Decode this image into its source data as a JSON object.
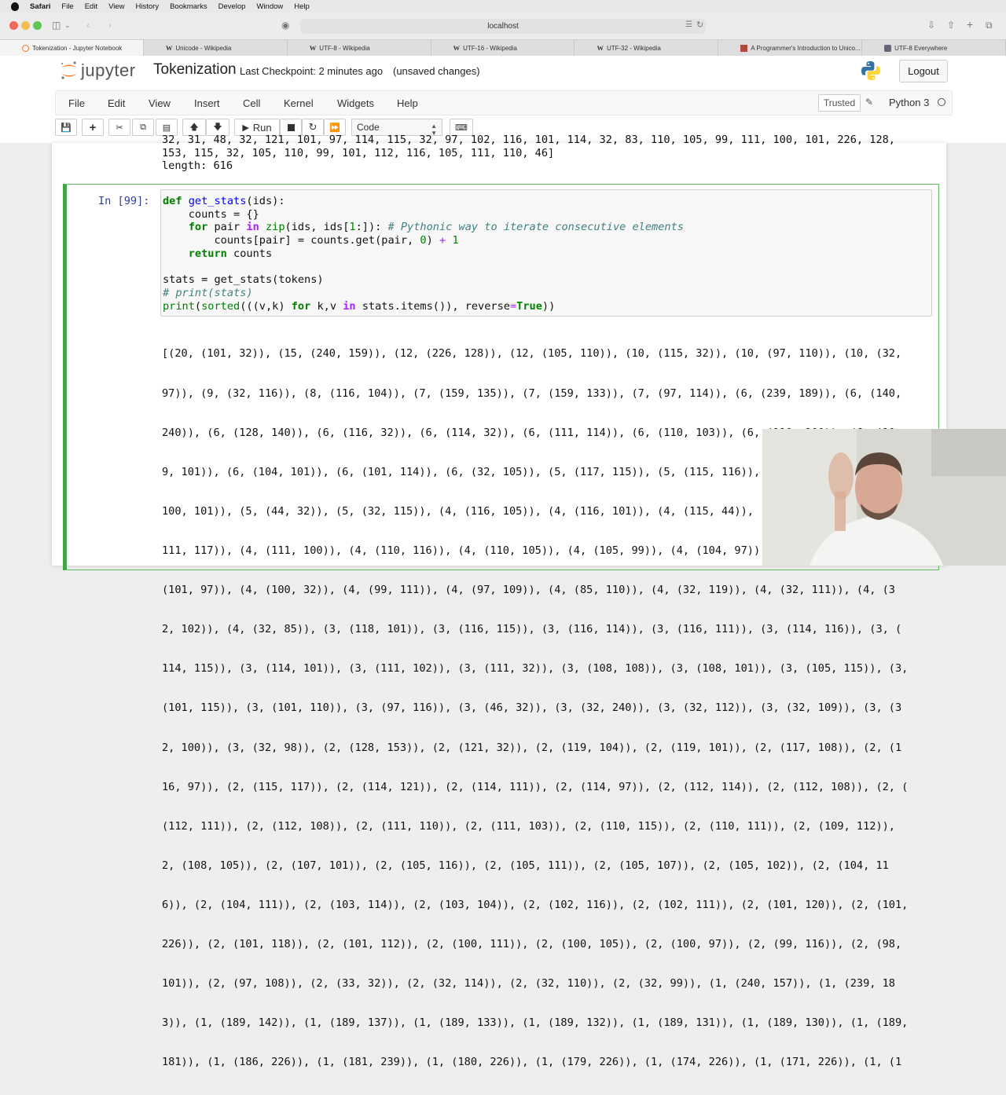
{
  "menubar": {
    "app": "Safari",
    "items": [
      "File",
      "Edit",
      "View",
      "History",
      "Bookmarks",
      "Develop",
      "Window",
      "Help"
    ]
  },
  "browser": {
    "address": "localhost",
    "tabs": [
      {
        "label": "Tokenization - Jupyter Notebook",
        "favicon": "jupyter"
      },
      {
        "label": "Unicode - Wikipedia",
        "favicon": "wikipedia"
      },
      {
        "label": "UTF-8 - Wikipedia",
        "favicon": "wikipedia"
      },
      {
        "label": "UTF-16 - Wikipedia",
        "favicon": "wikipedia"
      },
      {
        "label": "UTF-32 - Wikipedia",
        "favicon": "wikipedia"
      },
      {
        "label": "A Programmer's Introduction to Unico...",
        "favicon": "image"
      },
      {
        "label": "UTF-8 Everywhere",
        "favicon": "page"
      }
    ]
  },
  "jupyter": {
    "logo_text": "jupyter",
    "notebook_title": "Tokenization",
    "checkpoint": "Last Checkpoint: 2 minutes ago",
    "unsaved": "(unsaved changes)",
    "logout": "Logout",
    "menu": [
      "File",
      "Edit",
      "View",
      "Insert",
      "Cell",
      "Kernel",
      "Widgets",
      "Help"
    ],
    "trusted": "Trusted",
    "kernel": "Python 3",
    "run_label": "Run",
    "cell_type": "Code"
  },
  "prev_output": {
    "line0": "32, 31, 48, 32, 121, 101, 97, 114, 115, 32, 97, 102, 116, 101, 114, 32, 83, 110, 105, 99, 111, 100, 101, 226, 128,",
    "line1": "153, 115, 32, 105, 110, 99, 101, 112, 116, 105, 111, 110, 46]",
    "line2": "length: 616"
  },
  "cell": {
    "prompt": "In [99]:",
    "code": {
      "l1_def": "def",
      "l1_fn": "get_stats",
      "l1_rest": "(ids):",
      "l2": "    counts = {}",
      "l3_for": "for",
      "l3_a": " pair ",
      "l3_in": "in",
      "l3_zip": "zip",
      "l3_b": "(ids, ids[",
      "l3_one": "1",
      "l3_c": ":]): ",
      "l3_cm": "# Pythonic way to iterate consecutive elements",
      "l4_a": "        counts[pair] = counts.get(pair, ",
      "l4_zero": "0",
      "l4_b": ") ",
      "l4_plus": "+",
      "l4_one": "1",
      "l5_return": "return",
      "l5_rest": " counts",
      "l7": "stats = get_stats(tokens)",
      "l8_cm": "# print(stats)",
      "l9_print": "print",
      "l9_a": "(",
      "l9_sorted": "sorted",
      "l9_b": "(((v,k) ",
      "l9_for": "for",
      "l9_c": " k,v ",
      "l9_in": "in",
      "l9_d": " stats.items()), reverse",
      "l9_eq": "=",
      "l9_true": "True",
      "l9_e": "))"
    },
    "output_lines": [
      "[(20, (101, 32)), (15, (240, 159)), (12, (226, 128)), (12, (105, 110)), (10, (115, 32)), (10, (97, 110)), (10, (32,",
      "97)), (9, (32, 116)), (8, (116, 104)), (7, (159, 135)), (7, (159, 133)), (7, (97, 114)), (6, (239, 189)), (6, (140,",
      "240)), (6, (128, 140)), (6, (116, 32)), (6, (114, 32)), (6, (111, 114)), (6, (110, 103)), (6, (110, 100)), (6, (10",
      "9, 101)), (6, (104, 101)), (6, (101, 114)), (6, (32, 105)), (5, (117, 115)), (5, (115, 116)), (5, (110, 32)), (5, (",
      "100, 101)), (5, (44, 32)), (5, (32, 115)), (4, (116, 105)), (4, (116, 101)), (4, (115, 44)), (4, (114, 105)), (4, (",
      "111, 117)), (4, (111, 100)), (4, (110, 116)), (4, (110, 105)), (4, (105, 99)), (4, (104, 97)), (4, (103, 32)), (4,",
      "(101, 97)), (4, (100, 32)), (4, (99, 111)), (4, (97, 109)), (4, (85, 110)), (4, (32, 119)), (4, (32, 111)), (4, (3",
      "2, 102)), (4, (32, 85)), (3, (118, 101)), (3, (116, 115)), (3, (116, 114)), (3, (116, 111)), (3, (114, 116)), (3, (",
      "114, 115)), (3, (114, 101)), (3, (111, 102)), (3, (111, 32)), (3, (108, 108)), (3, (108, 101)), (3, (105, 115)), (3,",
      "(101, 115)), (3, (101, 110)), (3, (97, 116)), (3, (46, 32)), (3, (32, 240)), (3, (32, 112)), (3, (32, 109)), (3, (3",
      "2, 100)), (3, (32, 98)), (2, (128, 153)), (2, (121, 32)), (2, (119, 104)), (2, (119, 101)), (2, (117, 108)), (2, (1",
      "16, 97)), (2, (115, 117)), (2, (114, 121)), (2, (114, 111)), (2, (114, 97)), (2, (112, 114)), (2, (112, 108)), (2, (",
      "(112, 111)), (2, (112, 108)), (2, (111, 110)), (2, (111, 103)), (2, (110, 115)), (2, (110, 111)), (2, (109, 112)),",
      "2, (108, 105)), (2, (107, 101)), (2, (105, 116)), (2, (105, 111)), (2, (105, 107)), (2, (105, 102)), (2, (104, 11",
      "6)), (2, (104, 111)), (2, (103, 114)), (2, (103, 104)), (2, (102, 116)), (2, (102, 111)), (2, (101, 120)), (2, (101,",
      "226)), (2, (101, 118)), (2, (101, 112)), (2, (100, 111)), (2, (100, 105)), (2, (100, 97)), (2, (99, 116)), (2, (98,",
      "101)), (2, (97, 108)), (2, (33, 32)), (2, (32, 114)), (2, (32, 110)), (2, (32, 99)), (1, (240, 157)), (1, (239, 18",
      "3)), (1, (189, 142)), (1, (189, 137)), (1, (189, 133)), (1, (189, 132)), (1, (189, 131)), (1, (189, 130)), (1, (189,",
      "181)), (1, (186, 226)), (1, (181, 239)), (1, (180, 226)), (1, (179, 226)), (1, (174, 226)), (1, (171, 226)), (1, (1"
    ]
  }
}
